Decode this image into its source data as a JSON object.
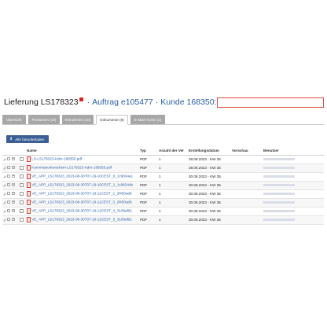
{
  "header": {
    "title": "Lieferung LS178323",
    "separator": "·",
    "order": "Auftrag e105477",
    "customer": "Kunde 168350:"
  },
  "tabs": [
    {
      "label": "Übersicht",
      "active": false
    },
    {
      "label": "Positionen (10)",
      "active": false
    },
    {
      "label": "Entnahmen (10)",
      "active": false
    },
    {
      "label": "Dokumente (8)",
      "active": true
    },
    {
      "label": "E-Mail-Archiv (1)",
      "active": false
    }
  ],
  "toolbar": {
    "download_label": "Alle herunterladen",
    "download_icon": "download-icon"
  },
  "table": {
    "columns": [
      "Name",
      "Typ",
      "Anzahl der Ver",
      "Erstellungsdatum",
      "Vorschau",
      "Benutzer"
    ],
    "rows": [
      {
        "name": "LS-LS178323-Kdnr-168350.pdf",
        "type": "PDF",
        "count": "1",
        "date": "28.08.2023 - KW 35"
      },
      {
        "name": "Kommissionierschein-LS178323-Kdnr-168350.pdf",
        "type": "PDF",
        "count": "1",
        "date": "28.08.2023 - KW 35"
      },
      {
        "name": "VE_APP_LS178323_2023-08-30T07-19-10CEST_0_1c9834a1",
        "type": "PDF",
        "count": "1",
        "date": "30.08.2023 - KW 35"
      },
      {
        "name": "VE_APP_LS178323_2023-08-30T07-19-10CEST_1_1c98344b",
        "type": "PDF",
        "count": "1",
        "date": "30.08.2023 - KW 35"
      },
      {
        "name": "VE_APP_LS178323_2023-08-30T07-19-11CEST_2_2f450ad6",
        "type": "PDF",
        "count": "1",
        "date": "30.08.2023 - KW 35"
      },
      {
        "name": "VE_APP_LS178323_2023-08-30T07-19-11CEST_3_2f450ad6",
        "type": "PDF",
        "count": "1",
        "date": "30.08.2023 - KW 35"
      },
      {
        "name": "VE_APP_LS178323_2023-08-30T07-19-12CEST_4_3109af91",
        "type": "PDF",
        "count": "1",
        "date": "30.08.2023 - KW 35"
      },
      {
        "name": "VE_APP_LS178323_2023-08-30T07-19-12CEST_5_3109af91",
        "type": "PDF",
        "count": "1",
        "date": "30.08.2023 - KW 35"
      }
    ]
  },
  "colors": {
    "link": "#2a5ea8",
    "tab_inactive": "#a7a7a7",
    "button": "#3b5e94",
    "highlight_border": "#e0483d"
  }
}
